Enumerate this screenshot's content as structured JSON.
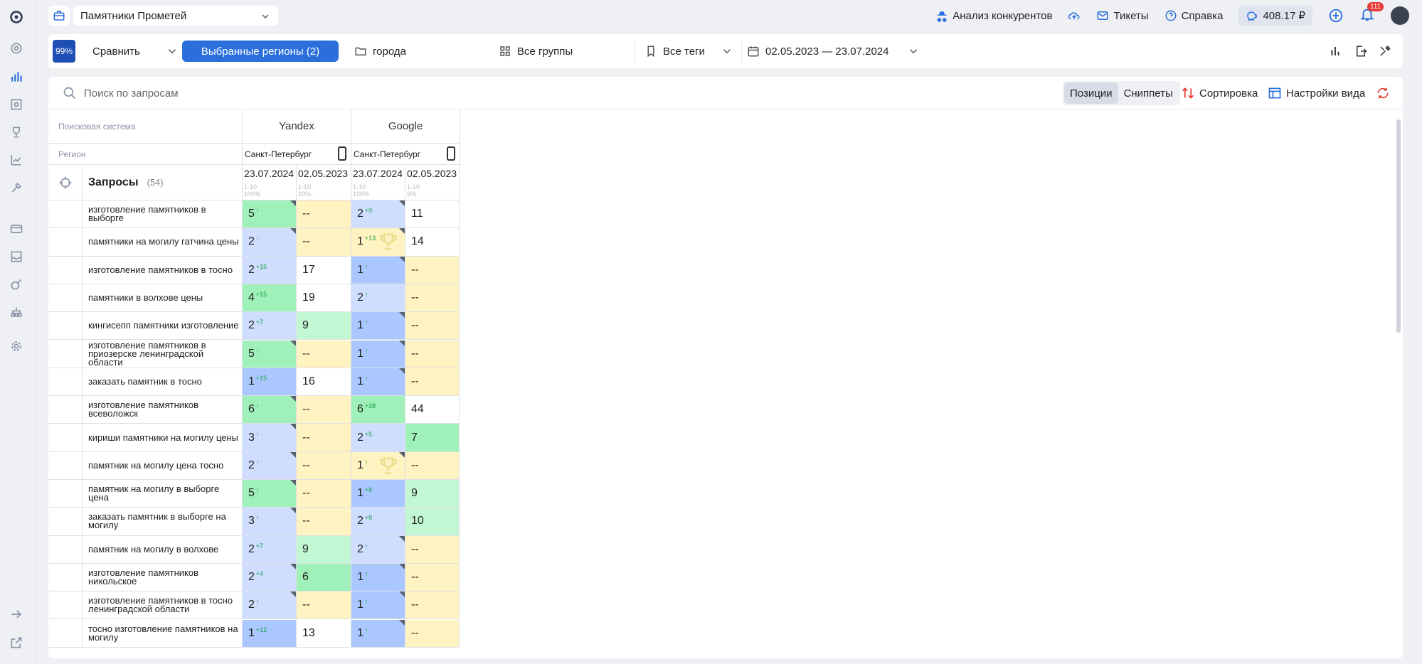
{
  "project": {
    "name": "Памятники Прометей"
  },
  "header": {
    "competitors": "Анализ конкурентов",
    "tickets": "Тикеты",
    "help": "Справка",
    "balance": "408.17 ₽",
    "notifications": "111"
  },
  "filters": {
    "percent": "99%",
    "compare": "Сравнить",
    "regions": "Выбранные регионы  (2)",
    "folder": "города",
    "groups": "Все группы",
    "tags": "Все теги",
    "dates": "02.05.2023 — 23.07.2024"
  },
  "search": {
    "placeholder": "Поиск по запросам"
  },
  "view": {
    "positions": "Позиции",
    "snippets": "Сниппеты",
    "sort": "Сортировка",
    "settings": "Настройки вида"
  },
  "table": {
    "label_engine": "Поисковая система",
    "label_region": "Регион",
    "queries_title": "Запросы",
    "queries_count": "(54)",
    "engines": [
      "Yandex",
      "Google"
    ],
    "regions": [
      "Санкт-Петербург",
      "Санкт-Петербург"
    ],
    "dates": [
      {
        "date": "23.07.2024",
        "range": "1-10",
        "pct": "100%"
      },
      {
        "date": "02.05.2023",
        "range": "1-10",
        "pct": "20%"
      },
      {
        "date": "23.07.2024",
        "range": "1-10",
        "pct": "100%"
      },
      {
        "date": "02.05.2023",
        "range": "1-10",
        "pct": "9%"
      }
    ],
    "rows": [
      {
        "q": "изготовление памятников в выборге",
        "cells": [
          [
            "5",
            "↑",
            "c-green",
            1
          ],
          [
            "--",
            "",
            "c-yellow",
            0
          ],
          [
            "2",
            "+9",
            "c-lblue",
            1
          ],
          [
            "11",
            "",
            "c-white",
            0
          ]
        ]
      },
      {
        "q": "памятники на могилу гатчина цены",
        "cells": [
          [
            "2",
            "↑",
            "c-lblue",
            1
          ],
          [
            "--",
            "",
            "c-yellow",
            0
          ],
          [
            "1",
            "+13",
            "c-yellow",
            1
          ],
          [
            "14",
            "",
            "c-white",
            0
          ]
        ],
        "trophy": 2
      },
      {
        "q": "изготовление памятников в тосно",
        "cells": [
          [
            "2",
            "+15",
            "c-lblue",
            0
          ],
          [
            "17",
            "",
            "c-white",
            0
          ],
          [
            "1",
            "↑",
            "c-blue",
            1
          ],
          [
            "--",
            "",
            "c-yellow",
            0
          ]
        ]
      },
      {
        "q": "памятники в волхове цены",
        "cells": [
          [
            "4",
            "+15",
            "c-green",
            0
          ],
          [
            "19",
            "",
            "c-white",
            0
          ],
          [
            "2",
            "↑",
            "c-lblue",
            0
          ],
          [
            "--",
            "",
            "c-yellow",
            0
          ]
        ]
      },
      {
        "q": "кингисепп памятники изготовление",
        "cells": [
          [
            "2",
            "+7",
            "c-lblue",
            0
          ],
          [
            "9",
            "",
            "c-lgreen",
            0
          ],
          [
            "1",
            "↑",
            "c-blue",
            1
          ],
          [
            "--",
            "",
            "c-yellow",
            0
          ]
        ]
      },
      {
        "q": "изготовление памятников в приозерске ленинградской области",
        "cells": [
          [
            "5",
            "↑",
            "c-green",
            1
          ],
          [
            "--",
            "",
            "c-yellow",
            0
          ],
          [
            "1",
            "↑",
            "c-blue",
            1
          ],
          [
            "--",
            "",
            "c-yellow",
            0
          ]
        ]
      },
      {
        "q": "заказать памятник в тосно",
        "cells": [
          [
            "1",
            "+15",
            "c-blue",
            0
          ],
          [
            "16",
            "",
            "c-white",
            0
          ],
          [
            "1",
            "↑",
            "c-blue",
            1
          ],
          [
            "--",
            "",
            "c-yellow",
            0
          ]
        ]
      },
      {
        "q": "изготовление памятников всеволожск",
        "cells": [
          [
            "6",
            "↑",
            "c-green",
            1
          ],
          [
            "--",
            "",
            "c-yellow",
            0
          ],
          [
            "6",
            "+38",
            "c-green",
            0
          ],
          [
            "44",
            "",
            "c-white",
            0
          ]
        ]
      },
      {
        "q": "кириши памятники на могилу цены",
        "cells": [
          [
            "3",
            "↑",
            "c-lblue",
            1
          ],
          [
            "--",
            "",
            "c-yellow",
            0
          ],
          [
            "2",
            "+5",
            "c-lblue",
            0
          ],
          [
            "7",
            "",
            "c-green",
            0
          ]
        ]
      },
      {
        "q": "памятник на могилу цена тосно",
        "cells": [
          [
            "2",
            "↑",
            "c-lblue",
            1
          ],
          [
            "--",
            "",
            "c-yellow",
            0
          ],
          [
            "1",
            "↑",
            "c-yellow",
            1
          ],
          [
            "--",
            "",
            "c-yellow",
            0
          ]
        ],
        "trophy": 2
      },
      {
        "q": "памятник на могилу в выборге цена",
        "cells": [
          [
            "5",
            "↑",
            "c-green",
            1
          ],
          [
            "--",
            "",
            "c-yellow",
            0
          ],
          [
            "1",
            "+8",
            "c-blue",
            0
          ],
          [
            "9",
            "",
            "c-lgreen",
            0
          ]
        ]
      },
      {
        "q": "заказать памятник в выборге на могилу",
        "cells": [
          [
            "3",
            "↑",
            "c-lblue",
            1
          ],
          [
            "--",
            "",
            "c-yellow",
            0
          ],
          [
            "2",
            "+8",
            "c-lblue",
            0
          ],
          [
            "10",
            "",
            "c-lgreen",
            0
          ]
        ]
      },
      {
        "q": "памятник на могилу в волхове",
        "cells": [
          [
            "2",
            "+7",
            "c-lblue",
            0
          ],
          [
            "9",
            "",
            "c-lgreen",
            0
          ],
          [
            "2",
            "↑",
            "c-lblue",
            1
          ],
          [
            "--",
            "",
            "c-yellow",
            0
          ]
        ]
      },
      {
        "q": "изготовление памятников никольское",
        "cells": [
          [
            "2",
            "+4",
            "c-lblue",
            1
          ],
          [
            "6",
            "",
            "c-green",
            0
          ],
          [
            "1",
            "↑",
            "c-blue",
            1
          ],
          [
            "--",
            "",
            "c-yellow",
            0
          ]
        ]
      },
      {
        "q": "изготовление памятников в тосно ленинградской области",
        "cells": [
          [
            "2",
            "↑",
            "c-lblue",
            1
          ],
          [
            "--",
            "",
            "c-yellow",
            0
          ],
          [
            "1",
            "↑",
            "c-blue",
            1
          ],
          [
            "--",
            "",
            "c-yellow",
            0
          ]
        ]
      },
      {
        "q": "тосно изготовление памятников на могилу",
        "cells": [
          [
            "1",
            "+12",
            "c-blue",
            0
          ],
          [
            "13",
            "",
            "c-white",
            0
          ],
          [
            "1",
            "↑",
            "c-blue",
            1
          ],
          [
            "--",
            "",
            "c-yellow",
            0
          ]
        ]
      }
    ]
  }
}
